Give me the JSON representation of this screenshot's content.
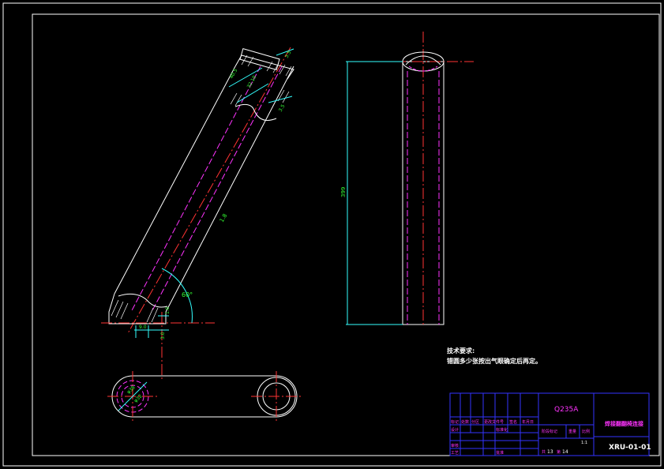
{
  "colors": {
    "background": "#000000",
    "outline": "#ffffff",
    "hidden": "#ff33ff",
    "center": "#ff3333",
    "dimension": "#33ffff",
    "dim_text": "#33ff33",
    "title_block": "#3333ff"
  },
  "technical_requirements": {
    "title": "技术要求:",
    "line1": "错圆多少张按出气眼确定后再定。"
  },
  "dimensions": {
    "length": "399",
    "angle": "60°",
    "pipe_angle": "1.8",
    "top_a": "40.5",
    "top_b": "32.10",
    "top_c": "3.5",
    "top_d": "3.5",
    "bot_a": "9.0",
    "bot_b": "3.0",
    "bot_c": "1.0",
    "circ_outer": "φ38",
    "circ_inner": "φ32"
  },
  "title_block": {
    "material": "Q235A",
    "part_name": "焊接翻翻椅连接",
    "drawing_no": "XRU-01-01",
    "scale_value": "1:1",
    "sheet_count_a": "13",
    "sheet_count_b": "14",
    "r1": [
      "标记",
      "处数",
      "分区",
      "更改文件号",
      "签名",
      "年月日"
    ],
    "r2": [
      "设计",
      "",
      "",
      "标准化",
      "",
      "阶段标记"
    ],
    "r3": [
      "审核"
    ],
    "r4": [
      "工艺",
      "",
      "",
      "批准"
    ],
    "stage_labels": [
      "阶段标记",
      "重量",
      "比例"
    ],
    "sheet_label_a": "共",
    "sheet_label_b": "第"
  }
}
